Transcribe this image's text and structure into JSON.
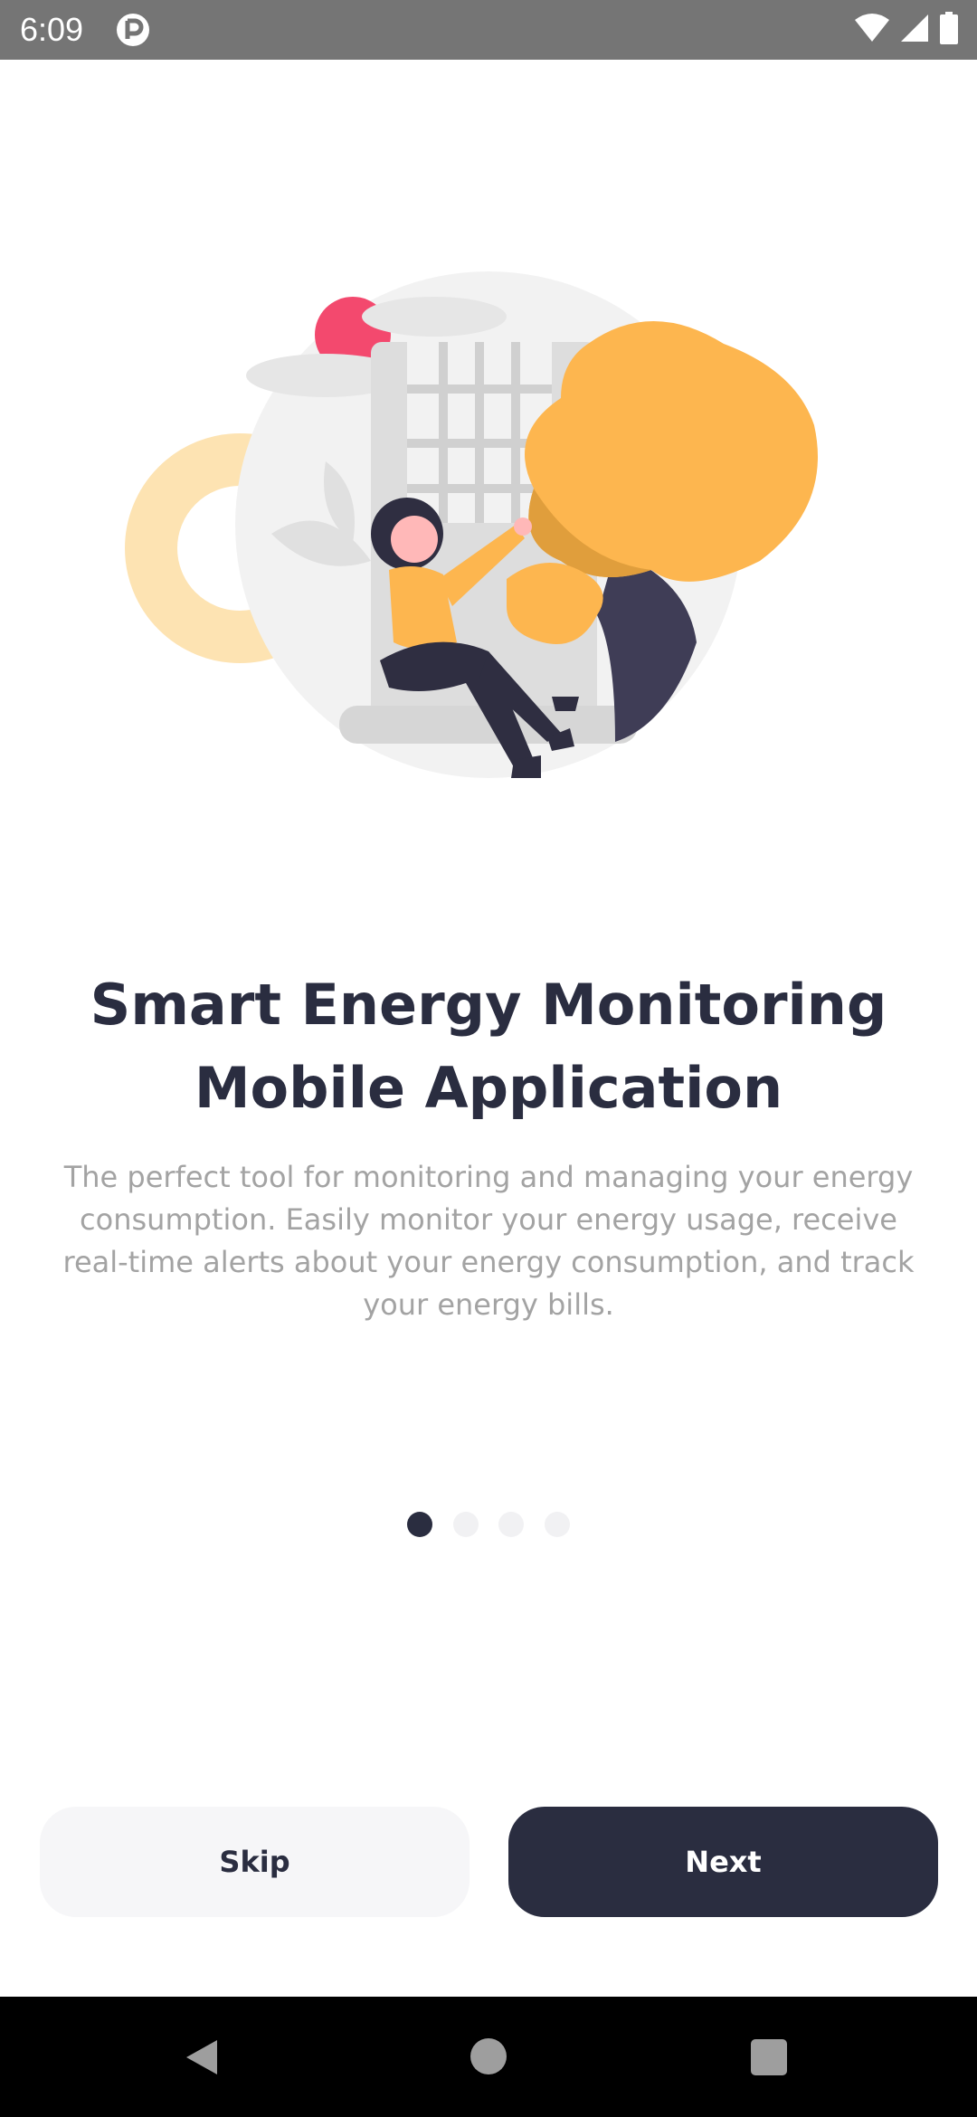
{
  "status_bar": {
    "time": "6:09",
    "app_icon": "notification-app-icon",
    "icons": [
      "wifi-icon",
      "signal-icon",
      "battery-icon"
    ]
  },
  "onboarding": {
    "illustration": "woman-sitting-by-window-illustration",
    "title_line1": "Smart Energy Monitoring",
    "title_line2": "Mobile Application",
    "description_line1": "The perfect tool for monitoring and managing your energy",
    "description_line2": "consumption. Easily monitor your energy usage, receive",
    "description_line3": "real-time alerts about your energy consumption, and track",
    "description_line4": "your energy bills.",
    "page_index": 1,
    "page_count": 4
  },
  "actions": {
    "skip_label": "Skip",
    "next_label": "Next"
  },
  "nav_bar": {
    "icons": [
      "back-icon",
      "home-icon",
      "recents-icon"
    ]
  },
  "colors": {
    "primary": "#2a2d40",
    "accent_yellow": "#fdb64f",
    "accent_pink": "#f3496e",
    "muted_text": "#a3a3a3",
    "light_button": "#f6f6f8",
    "status_bar": "#757575"
  }
}
